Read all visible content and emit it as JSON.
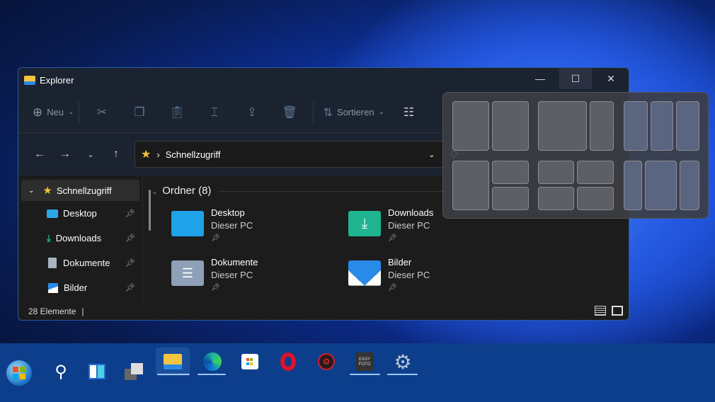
{
  "window": {
    "title": "Explorer",
    "minimize": "—",
    "maximize": "☐",
    "close": "✕"
  },
  "toolbar": {
    "new_label": "Neu",
    "sort_label": "Sortieren"
  },
  "address": {
    "path": "Schnellzugriff"
  },
  "sidebar": {
    "items": [
      {
        "label": "Schnellzugriff"
      },
      {
        "label": "Desktop"
      },
      {
        "label": "Downloads"
      },
      {
        "label": "Dokumente"
      },
      {
        "label": "Bilder"
      }
    ]
  },
  "main": {
    "group": "Ordner (8)",
    "folders": [
      {
        "name": "Desktop",
        "location": "Dieser PC",
        "color": "#1fa3e8"
      },
      {
        "name": "Downloads",
        "location": "Dieser PC",
        "color": "#1fb38f"
      },
      {
        "name": "Dokumente",
        "location": "Dieser PC",
        "color": "#8da0b8"
      },
      {
        "name": "Bilder",
        "location": "Dieser PC",
        "color": "#2a8ae8"
      }
    ]
  },
  "status": {
    "count": "28 Elemente"
  },
  "taskbar": {
    "apps": [
      "start",
      "search",
      "widgets",
      "task-view",
      "explorer",
      "edge",
      "store",
      "opera",
      "iobit",
      "easy-foto",
      "settings"
    ],
    "easyfoto_label": "EASY FOTO"
  }
}
